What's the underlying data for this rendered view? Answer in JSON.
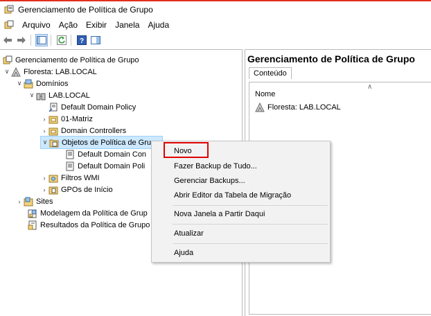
{
  "window": {
    "title": "Gerenciamento de Política de Grupo"
  },
  "menu": [
    "Arquivo",
    "Ação",
    "Exibir",
    "Janela",
    "Ajuda"
  ],
  "tree": {
    "root": "Gerenciamento de Política de Grupo",
    "forest": "Floresta: LAB.LOCAL",
    "domains": "Domínios",
    "domain": "LAB.LOCAL",
    "default_policy": "Default Domain Policy",
    "matriz": "01-Matriz",
    "dcs": "Domain Controllers",
    "gpo_folder": "Objetos de Política de Grupo",
    "gpo_item_1": "Default Domain Con",
    "gpo_item_2": "Default Domain Poli",
    "wmi": "Filtros WMI",
    "starter": "GPOs de Início",
    "sites": "Sites",
    "modeling": "Modelagem da Política de Grup",
    "results": "Resultados da Política de Grupo"
  },
  "right": {
    "title": "Gerenciamento de Política de Grupo",
    "tab": "Conteúdo",
    "column": "Nome",
    "item": "Floresta: LAB.LOCAL"
  },
  "context_menu": {
    "novo": "Novo",
    "backup": "Fazer Backup de Tudo...",
    "manage": "Gerenciar Backups...",
    "migration": "Abrir Editor da Tabela de Migração",
    "new_window": "Nova Janela a Partir Daqui",
    "refresh": "Atualizar",
    "help": "Ajuda"
  },
  "colors": {
    "accent_top": "#e0301e",
    "highlight_box": "#e00000",
    "selection": "#cce8ff"
  }
}
